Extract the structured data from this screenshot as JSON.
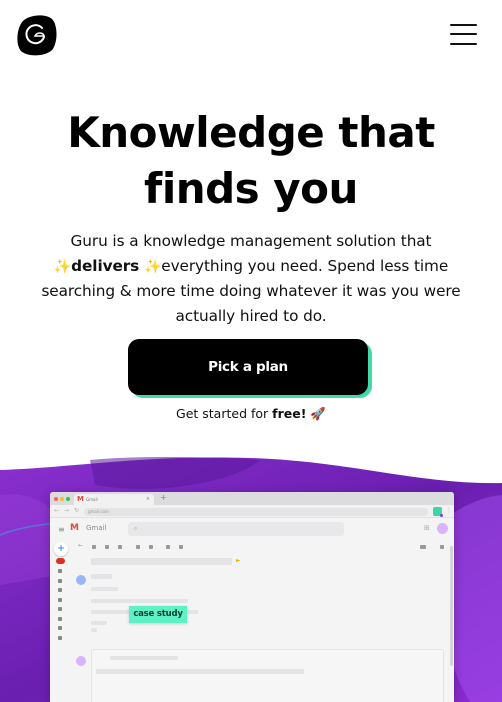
{
  "header": {
    "logo_alt": "Guru logo",
    "menu_label": "Open menu"
  },
  "hero": {
    "headline_line1": "Knowledge that",
    "headline_line2": "finds you",
    "sub_part1": "Guru is a knowledge management solution that",
    "sparkle": "✨",
    "sub_bold": "delivers",
    "sub_part2": "everything you need. Spend less time searching & more time doing whatever it was you were actually hired to do."
  },
  "cta": {
    "button_label": "Pick a plan",
    "note_prefix": "Get started for ",
    "note_bold": "free!",
    "note_emoji": "🚀"
  },
  "browser_mock": {
    "tab_title": "Gmail",
    "tab_close": "×",
    "new_tab": "+",
    "url": "gmail.com",
    "app_name": "Gmail",
    "search_icon": "🔍",
    "overlay_label": "case study"
  },
  "colors": {
    "accent_green": "#45d8a8",
    "tag_green": "#5cf2c5",
    "purple": "#7c22c4",
    "button_bg": "#000000"
  }
}
